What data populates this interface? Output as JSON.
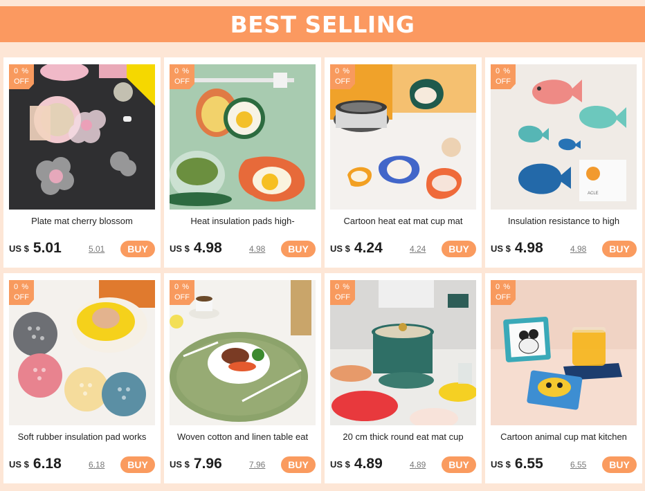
{
  "banner": {
    "title": "BEST SELLING"
  },
  "badge": {
    "pct": "0 %",
    "off": "OFF"
  },
  "currency": "US $",
  "buy_label": "BUY",
  "colors": {
    "banner": "#fb9960",
    "buy": "#fa9b5f",
    "badge": "#f89a5e",
    "background": "#fde6d6"
  },
  "products": [
    {
      "title": "Plate mat cherry blossom",
      "price": "5.01",
      "old_price": "5.01",
      "image": "sakura-coaster-photo"
    },
    {
      "title": "Heat insulation pads high-",
      "price": "4.98",
      "old_price": "4.98",
      "image": "egg-pad-photo"
    },
    {
      "title": "Cartoon heat eat mat cup mat",
      "price": "4.24",
      "old_price": "4.24",
      "image": "cartoon-mat-photo"
    },
    {
      "title": "Insulation resistance to high",
      "price": "4.98",
      "old_price": "4.98",
      "image": "fish-mat-photo"
    },
    {
      "title": "Soft rubber insulation pad works",
      "price": "6.18",
      "old_price": "6.18",
      "image": "rubber-pad-photo"
    },
    {
      "title": "Woven cotton and linen table eat",
      "price": "7.96",
      "old_price": "7.96",
      "image": "woven-placemat-photo"
    },
    {
      "title": "20 cm thick round eat mat cup",
      "price": "4.89",
      "old_price": "4.89",
      "image": "round-mat-photo"
    },
    {
      "title": "Cartoon animal cup mat kitchen",
      "price": "6.55",
      "old_price": "6.55",
      "image": "animal-cup-mat-photo"
    }
  ]
}
